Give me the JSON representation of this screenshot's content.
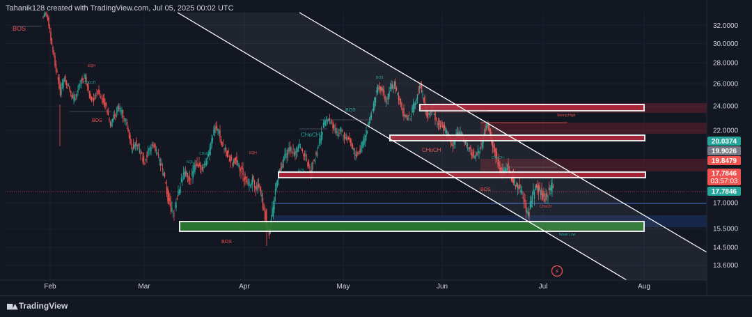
{
  "header": {
    "text": "Tahanik128 created with TradingView.com, Jul 05, 2025 00:02 UTC"
  },
  "footer": {
    "brand": "TradingView",
    "logo_icon": "tradingview-logo-icon"
  },
  "colors": {
    "background": "#131722",
    "up": "#26a69a",
    "down": "#ef5350",
    "zone_red": "#b2283a",
    "zone_green": "#2e7d32",
    "zone_blue": "#1a2d57",
    "channel_line": "#ffffff",
    "bos": "#ef5350",
    "choch": "#26a69a"
  },
  "chart_data": {
    "type": "candlestick",
    "y_scale": "log",
    "ylim": [
      12.9,
      33.5
    ],
    "y_ticks": [
      "32.0000",
      "30.0000",
      "28.0000",
      "26.0000",
      "24.0000",
      "22.0000",
      "17.0000",
      "15.5000",
      "14.5000",
      "13.6000"
    ],
    "x_labels": [
      "Feb",
      "Mar",
      "Apr",
      "May",
      "Jun",
      "Jul",
      "Aug"
    ],
    "price_tags": [
      {
        "value": "20.0374",
        "color": "#26a69a",
        "price": 20.0374
      },
      {
        "value": "19.9026",
        "color": "#787b86",
        "price": 19.9026
      },
      {
        "value": "19.8479",
        "color": "#ef5350",
        "price": 19.8479
      },
      {
        "value": "17.7846",
        "sub": "03:57:03",
        "color": "#ef5350",
        "price": 17.7846
      },
      {
        "value": "17.7846",
        "color": "#26a69a",
        "price": 17.7846
      }
    ],
    "current_price": 17.7846,
    "path": [
      [
        0,
        33
      ],
      [
        4,
        33.5
      ],
      [
        8,
        32.8
      ],
      [
        14,
        29.8
      ],
      [
        20,
        27.4
      ],
      [
        26,
        25.2
      ],
      [
        32,
        26.5
      ],
      [
        38,
        25.6
      ],
      [
        44,
        24.6
      ],
      [
        50,
        25.2
      ],
      [
        56,
        26.4
      ],
      [
        62,
        26.6
      ],
      [
        68,
        24.8
      ],
      [
        74,
        24.6
      ],
      [
        80,
        25.4
      ],
      [
        86,
        24.8
      ],
      [
        92,
        23.8
      ],
      [
        98,
        22.4
      ],
      [
        104,
        23.2
      ],
      [
        110,
        23.9
      ],
      [
        116,
        23.2
      ],
      [
        122,
        22.3
      ],
      [
        128,
        20.6
      ],
      [
        134,
        21.1
      ],
      [
        140,
        20.4
      ],
      [
        146,
        19.6
      ],
      [
        152,
        20.2
      ],
      [
        158,
        21.0
      ],
      [
        164,
        20.4
      ],
      [
        170,
        19.5
      ],
      [
        176,
        18.4
      ],
      [
        182,
        17.0
      ],
      [
        188,
        16.2
      ],
      [
        194,
        17.4
      ],
      [
        200,
        18.4
      ],
      [
        206,
        18.9
      ],
      [
        212,
        18.3
      ],
      [
        218,
        19.3
      ],
      [
        224,
        19.7
      ],
      [
        230,
        19.0
      ],
      [
        236,
        19.8
      ],
      [
        242,
        21.0
      ],
      [
        248,
        22.4
      ],
      [
        254,
        21.8
      ],
      [
        260,
        20.7
      ],
      [
        266,
        20.2
      ],
      [
        272,
        19.6
      ],
      [
        278,
        19.8
      ],
      [
        284,
        19.3
      ],
      [
        290,
        18.6
      ],
      [
        296,
        18.2
      ],
      [
        302,
        18.4
      ],
      [
        308,
        18.0
      ],
      [
        314,
        17.6
      ],
      [
        320,
        16.3
      ],
      [
        326,
        15.2
      ],
      [
        332,
        16.8
      ],
      [
        338,
        18.6
      ],
      [
        344,
        19.3
      ],
      [
        350,
        20.2
      ],
      [
        356,
        20.6
      ],
      [
        362,
        20.2
      ],
      [
        368,
        20.8
      ],
      [
        374,
        20.4
      ],
      [
        380,
        19.8
      ],
      [
        386,
        19.1
      ],
      [
        392,
        20.1
      ],
      [
        398,
        21.0
      ],
      [
        404,
        22.4
      ],
      [
        410,
        23.0
      ],
      [
        416,
        22.6
      ],
      [
        422,
        21.8
      ],
      [
        428,
        22.0
      ],
      [
        434,
        21.4
      ],
      [
        440,
        21.3
      ],
      [
        446,
        20.6
      ],
      [
        452,
        20.1
      ],
      [
        458,
        20.6
      ],
      [
        464,
        21.4
      ],
      [
        470,
        22.8
      ],
      [
        476,
        24.0
      ],
      [
        482,
        25.8
      ],
      [
        488,
        25.4
      ],
      [
        494,
        24.4
      ],
      [
        500,
        25.6
      ],
      [
        506,
        26.0
      ],
      [
        512,
        24.6
      ],
      [
        518,
        23.6
      ],
      [
        524,
        22.8
      ],
      [
        530,
        23.4
      ],
      [
        536,
        24.4
      ],
      [
        542,
        26.0
      ],
      [
        548,
        24.6
      ],
      [
        554,
        23.0
      ],
      [
        560,
        23.8
      ],
      [
        566,
        22.8
      ],
      [
        572,
        22.4
      ],
      [
        578,
        22.1
      ],
      [
        584,
        21.5
      ],
      [
        590,
        20.8
      ],
      [
        596,
        21.6
      ],
      [
        602,
        21.8
      ],
      [
        608,
        21.0
      ],
      [
        614,
        20.6
      ],
      [
        620,
        20.1
      ],
      [
        626,
        20.4
      ],
      [
        632,
        21.2
      ],
      [
        638,
        22.4
      ],
      [
        644,
        21.6
      ],
      [
        650,
        20.4
      ],
      [
        656,
        19.3
      ],
      [
        662,
        18.9
      ],
      [
        668,
        19.5
      ],
      [
        674,
        18.6
      ],
      [
        680,
        18.2
      ],
      [
        686,
        17.9
      ],
      [
        692,
        17.0
      ],
      [
        698,
        16.2
      ],
      [
        704,
        17.4
      ],
      [
        710,
        18.0
      ],
      [
        716,
        17.6
      ],
      [
        722,
        17.3
      ],
      [
        728,
        17.8
      ],
      [
        734,
        18.1
      ],
      [
        740,
        18.6
      ],
      [
        746,
        19.4
      ],
      [
        752,
        18.8
      ],
      [
        758,
        17.78
      ]
    ]
  },
  "annotations": [
    {
      "text": "BOS",
      "kind": "bos"
    },
    {
      "text": "BOS",
      "kind": "bos"
    },
    {
      "text": "BOS",
      "kind": "bos"
    },
    {
      "text": "BOS",
      "kind": "choch"
    },
    {
      "text": "BOS",
      "kind": "bos"
    },
    {
      "text": "BOS",
      "kind": "choch"
    },
    {
      "text": "CHoCH",
      "kind": "choch"
    },
    {
      "text": "CHoCH",
      "kind": "bos"
    },
    {
      "text": "CHoCH",
      "kind": "choch"
    },
    {
      "text": "CHoCH",
      "kind": "choch"
    },
    {
      "text": "CHoCH",
      "kind": "choch"
    },
    {
      "text": "CHoCH",
      "kind": "bos"
    },
    {
      "text": "EQH",
      "kind": "bos"
    },
    {
      "text": "EQH",
      "kind": "bos"
    },
    {
      "text": "EQL",
      "kind": "choch"
    },
    {
      "text": "EQL",
      "kind": "choch"
    },
    {
      "text": "EQL",
      "kind": "choch"
    },
    {
      "text": "Strong High",
      "kind": "bos"
    },
    {
      "text": "Weak Low",
      "kind": "choch"
    }
  ]
}
